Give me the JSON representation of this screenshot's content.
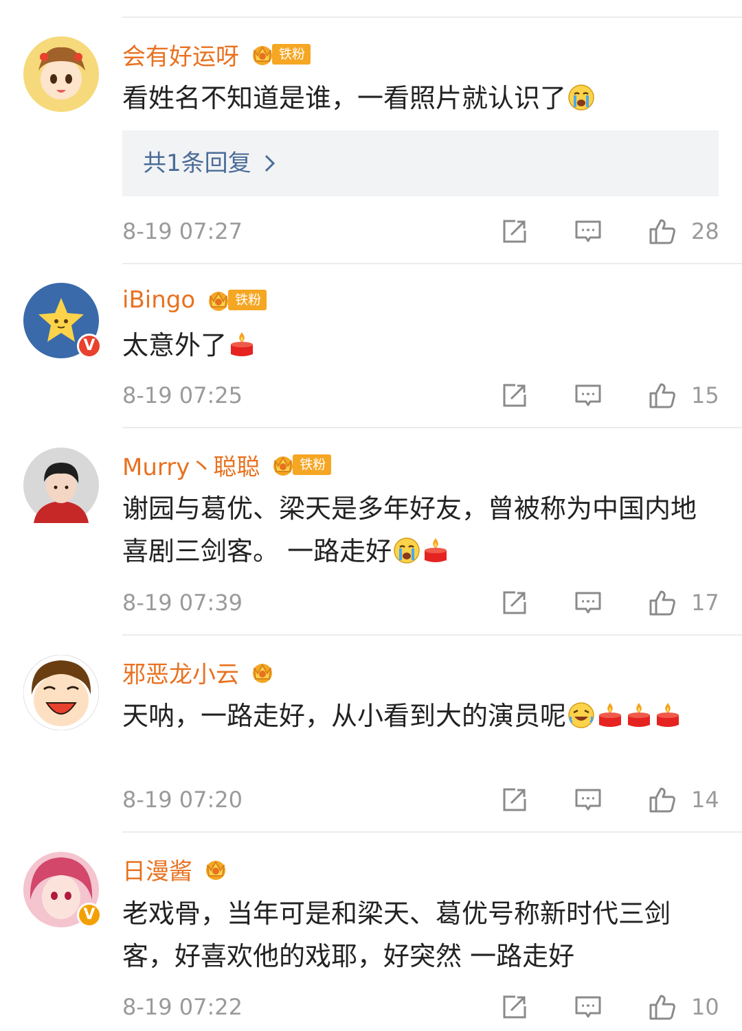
{
  "comments": [
    {
      "username": "会有好运呀",
      "level": "4",
      "fan_tag": "铁粉",
      "text": "看姓名不知道是谁，一看照片就认识了",
      "emojis": [
        "crying-face-emoji"
      ],
      "reply_summary": "共1条回复",
      "timestamp": "8-19 07:27",
      "likes": "28"
    },
    {
      "username": "iBingo",
      "level": "6",
      "fan_tag": "铁粉",
      "verified": "V",
      "text": "太意外了",
      "emojis": [
        "candle-emoji"
      ],
      "timestamp": "8-19 07:25",
      "likes": "15"
    },
    {
      "username": "Murry丶聪聪",
      "level": "5",
      "fan_tag": "铁粉",
      "text": "谢园与葛优、梁天是多年好友，曾被称为中国内地喜剧三剑客。 一路走好",
      "emojis": [
        "crying-face-emoji",
        "candle-emoji"
      ],
      "timestamp": "8-19 07:39",
      "likes": "17"
    },
    {
      "username": "邪恶龙小云",
      "level": "3",
      "text": "天呐，一路走好，从小看到大的演员呢",
      "emojis": [
        "laugh-cry-emoji",
        "candle-emoji",
        "candle-emoji",
        "candle-emoji"
      ],
      "timestamp": "8-19 07:20",
      "likes": "14"
    },
    {
      "username": "日漫酱",
      "level": "",
      "verified": "V",
      "text": "老戏骨，当年可是和梁天、葛优号称新时代三剑客，好喜欢他的戏耶，好突然 一路走好",
      "emojis": [],
      "timestamp": "8-19 07:22",
      "likes": "10"
    }
  ],
  "colors": {
    "username": "#e8711f",
    "fan_tag": "#f5a623",
    "reply_link": "#4a6c97",
    "meta": "#9a9a9a"
  },
  "icons": [
    "share-icon",
    "comment-icon",
    "like-icon",
    "chevron-right-icon",
    "crown-level-icon",
    "verified-icon"
  ]
}
